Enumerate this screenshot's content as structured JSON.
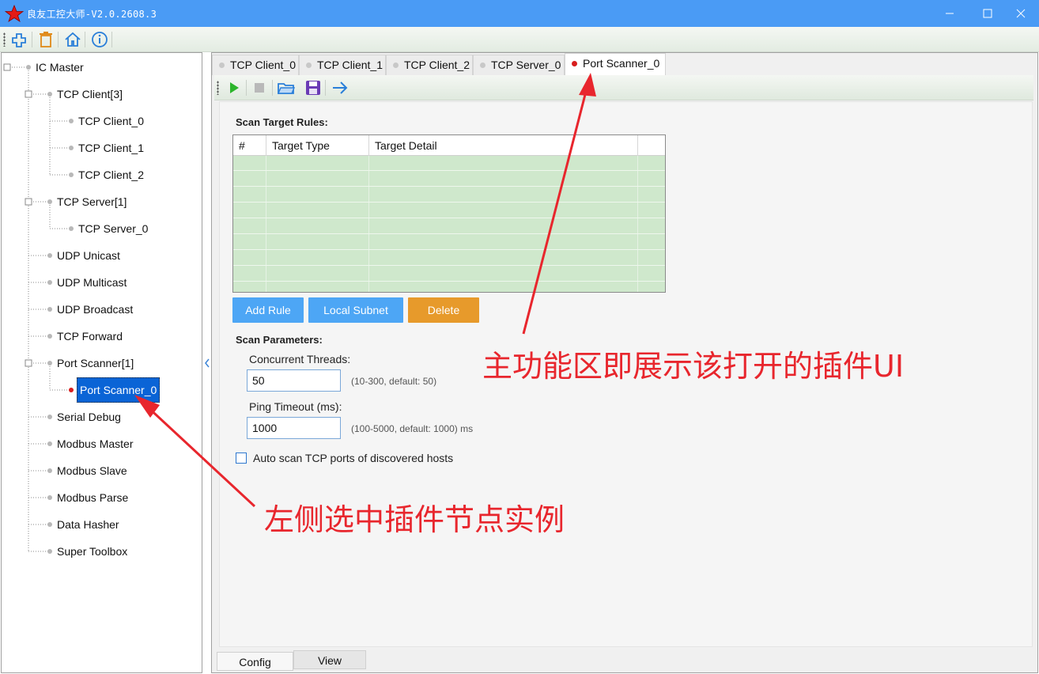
{
  "window": {
    "title": "良友工控大师-V2.0.2608.3"
  },
  "tree": {
    "root": "IC Master",
    "nodes": [
      {
        "label": "TCP Client[3]"
      },
      {
        "label": "TCP Client_0"
      },
      {
        "label": "TCP Client_1"
      },
      {
        "label": "TCP Client_2"
      },
      {
        "label": "TCP Server[1]"
      },
      {
        "label": "TCP Server_0"
      },
      {
        "label": "UDP Unicast"
      },
      {
        "label": "UDP Multicast"
      },
      {
        "label": "UDP Broadcast"
      },
      {
        "label": "TCP Forward"
      },
      {
        "label": "Port Scanner[1]"
      },
      {
        "label": "Port Scanner_0"
      },
      {
        "label": "Serial Debug"
      },
      {
        "label": "Modbus Master"
      },
      {
        "label": "Modbus Slave"
      },
      {
        "label": "Modbus Parse"
      },
      {
        "label": "Data Hasher"
      },
      {
        "label": "Super Toolbox"
      }
    ]
  },
  "tabs": [
    {
      "label": "TCP Client_0"
    },
    {
      "label": "TCP Client_1"
    },
    {
      "label": "TCP Client_2"
    },
    {
      "label": "TCP Server_0"
    },
    {
      "label": "Port Scanner_0"
    }
  ],
  "scan_rules": {
    "title": "Scan Target Rules:",
    "columns": [
      "#",
      "Target Type",
      "Target Detail"
    ],
    "buttons": {
      "add": "Add Rule",
      "subnet": "Local Subnet",
      "delete": "Delete"
    }
  },
  "scan_params": {
    "title": "Scan Parameters:",
    "threads_label": "Concurrent Threads:",
    "threads_value": "50",
    "threads_hint": "(10-300, default: 50)",
    "timeout_label": "Ping Timeout (ms):",
    "timeout_value": "1000",
    "timeout_hint": "(100-5000, default: 1000) ms",
    "auto_scan_label": "Auto scan TCP ports of discovered hosts"
  },
  "bottom_tabs": {
    "config": "Config",
    "view": "View"
  },
  "annotations": {
    "main_area": "主功能区即展示该打开的插件UI",
    "left_select": "左侧选中插件节点实例"
  },
  "colors": {
    "titlebar": "#4a9bf5",
    "selection": "#0a64d6",
    "table_bg": "#cfe8cc",
    "button_blue": "#4da6f5",
    "button_orange": "#e79a2b",
    "annotation": "#e8262d"
  }
}
